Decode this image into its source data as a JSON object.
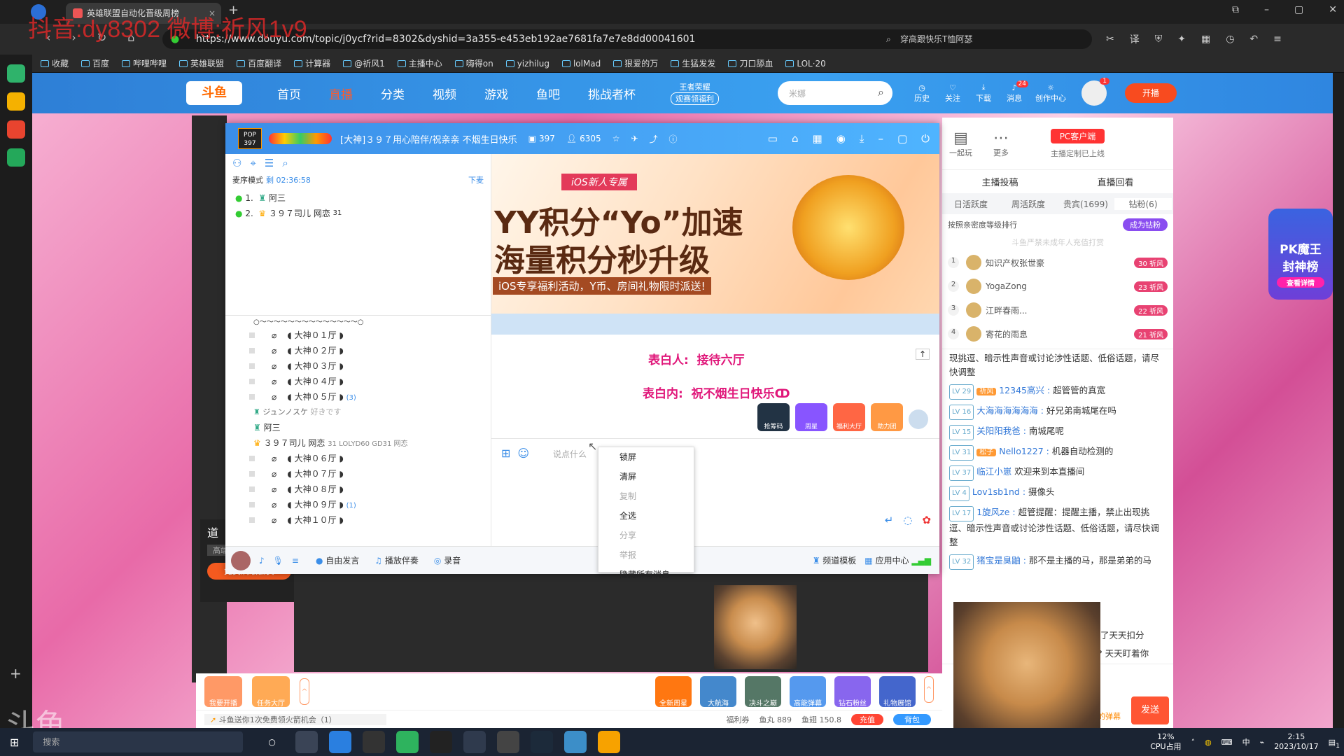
{
  "browser": {
    "tab_title": "英雄联盟自动化晋级周榜",
    "url": "https://www.douyu.com/topic/j0ycf?rid=8302&dyshid=3a355-e453eb192ae7681fa7e7e8dd00041601",
    "search_text": "穿高跟快乐T恤阿瑟",
    "watermark": "抖音:dy8302 微博:祈风1v9",
    "bookmarks": [
      "收藏",
      "百度",
      "哔哩哔哩",
      "英雄联盟",
      "百度翻译",
      "计算器",
      "@祈风1",
      "主播中心",
      "嗨得on",
      "yizhilug",
      "lolMad",
      "狠爱的万",
      "生猛发发",
      "刀口舔血",
      "LOL·20"
    ]
  },
  "douyu_nav": {
    "logo": "斗鱼",
    "items": [
      "首页",
      "直播",
      "分类",
      "视频",
      "游戏",
      "鱼吧",
      "挑战者杯"
    ],
    "promo_top": "王者荣耀",
    "promo_bottom": "观赛领福利",
    "search_placeholder": "米娜",
    "right": [
      "历史",
      "关注",
      "下载",
      "消息",
      "创作中心"
    ],
    "msg_badge": "24",
    "avatar_badge": "1",
    "live_btn": "开播"
  },
  "yy": {
    "pop_label": "POP",
    "pop_num": "397",
    "title": "[大神]３９７用心陪伴/祝亲亲 不烟生日快乐",
    "id_num": "397",
    "people": "6305",
    "mode_label": "麦序模式",
    "mode_time": "剩 02:36:58",
    "mic_queue": "下麦",
    "queue": [
      {
        "num": "1.",
        "name": "阿三"
      },
      {
        "num": "2.",
        "name": "３９７司儿 网恋",
        "extra": "31"
      }
    ],
    "channels_header": "○～～～～～～～～～～～～～～○",
    "channels": [
      {
        "name": "大神０１厅",
        "count": ""
      },
      {
        "name": "大神０２厅",
        "count": ""
      },
      {
        "name": "大神０３厅",
        "count": ""
      },
      {
        "name": "大神０４厅",
        "count": ""
      },
      {
        "name": "大神０５厅",
        "count": "(3)"
      }
    ],
    "users": [
      {
        "name": "ジュンノスケ",
        "extra": "好きです"
      },
      {
        "name": "阿三",
        "extra": ""
      },
      {
        "name": "３９７司儿 网恋",
        "extra": "31  LOLYD60 GD31 网恋"
      }
    ],
    "channels2": [
      {
        "name": "大神０６厅",
        "count": ""
      },
      {
        "name": "大神０７厅",
        "count": ""
      },
      {
        "name": "大神０８厅",
        "count": ""
      },
      {
        "name": "大神０９厅",
        "count": "(1)"
      },
      {
        "name": "大神１０厅",
        "count": ""
      }
    ],
    "banner": {
      "tag": "iOS新人专属",
      "line1": "YY积分“Yo”加速",
      "line2": "海量积分秒升级",
      "line3": "iOS专享福利活动，Y币、房间礼物限时派送!"
    },
    "confess_from_label": "表白人:",
    "confess_from": "接待六厅",
    "confess_to_label": "表白内:",
    "confess_to": "祝不烟生日快乐ↀ",
    "activity_icons": [
      "抢筹码",
      "周星",
      "福利大厅",
      "助力团"
    ],
    "input_placeholder": "说点什么",
    "bottom": [
      "自由发言",
      "播放伴奏",
      "录音",
      "频道模板",
      "应用中心"
    ]
  },
  "context_menu": [
    "锁屏",
    "清屏",
    "复制",
    "全选",
    "分享",
    "举报",
    "隐藏所有消息"
  ],
  "context_menu_disabled": [
    false,
    false,
    true,
    false,
    true,
    true,
    false
  ],
  "douyu_right": {
    "top_icons": [
      "一起玩",
      "更多"
    ],
    "pc_client": "PC客户端",
    "pc_sub": "主播定制已上线",
    "links": [
      "主播投稿",
      "直播回看"
    ],
    "tabs": [
      "日活跃度",
      "周活跃度",
      "贵宾(1699)",
      "钻粉(6)"
    ],
    "sort_label": "按照亲密度等级排行",
    "become_fan": "成为钻粉",
    "notice": "斗鱼严禁未成年人充值打赏",
    "ranks": [
      {
        "n": "1",
        "name": "知识产权张世豪",
        "lv": "30",
        "badge": "祈风"
      },
      {
        "n": "2",
        "name": "YogaZong",
        "lv": "23",
        "badge": "祈风"
      },
      {
        "n": "3",
        "name": "江畔春雨...",
        "lv": "22",
        "badge": "祈风"
      },
      {
        "n": "4",
        "name": "寄花的雨息",
        "lv": "21",
        "badge": "祈风"
      }
    ],
    "messages": [
      {
        "lv": "",
        "badge": "",
        "nick": "",
        "text": "现挑逗、暗示性声音或讨论涉性话题、低俗话题，请尽快调整"
      },
      {
        "lv": "LV 29",
        "badge": "祈风",
        "nick": "12345高兴 :",
        "text": "超管管的真宽"
      },
      {
        "lv": "LV 16",
        "badge": "",
        "nick": "大海海海海海海 :",
        "text": "好兄弟南城尾在吗"
      },
      {
        "lv": "LV 15",
        "badge": "",
        "nick": "关阳阳我爸 :",
        "text": "南城尾呢"
      },
      {
        "lv": "LV 31",
        "badge": "松子",
        "nick": "Nello1227 :",
        "text": "机器自动检测的"
      },
      {
        "lv": "LV 37",
        "badge": "",
        "nick": "临江小崽",
        "text": "欢迎来到本直播间"
      },
      {
        "lv": "LV 4",
        "badge": "",
        "nick": "Lov1sb1nd :",
        "text": "摄像头"
      },
      {
        "lv": "LV 17",
        "badge": "",
        "nick": "1旋风ze :",
        "text": "超管提醒：提醒主播，禁止出现挑逗、暗示性声音或讨论涉性话题、低俗话题，请尽快调整"
      },
      {
        "lv": "LV 32",
        "badge": "",
        "nick": "猪宝是臭鼬 :",
        "text": "那不是主播的马，那是弟弟的马"
      }
    ],
    "cut_text1": "了天天扣分",
    "cut_text2": "? 天天盯着你",
    "send": "发送",
    "send_hint": "的弹幕"
  },
  "pk_badge": {
    "line1": "PK魔王",
    "line2": "封神榜",
    "line3": "查看详情"
  },
  "left_under": {
    "title": "道",
    "tabs": [
      "高端",
      "打会"
    ],
    "btn": "免费满级会员",
    "watermark": "斗鱼"
  },
  "gifts": {
    "left": [
      "我要开播",
      "任务大厅"
    ],
    "right": [
      "全新周星",
      "大航海",
      "决斗之巅",
      "高能弹幕",
      "钻石粉丝",
      "礼物展馆"
    ],
    "tip": "斗鱼送你1次免费领火箭机会（1）",
    "welfare": "福利券",
    "fish_ball": "鱼丸 889",
    "fish_fin": "鱼翅 150.8",
    "recharge": "充值",
    "bag": "背包"
  },
  "taskbar": {
    "search": "搜索",
    "cpu_pct": "12%",
    "cpu_label": "CPU占用",
    "time": "2:15",
    "date": "2023/10/17",
    "ime": "中",
    "notif": "1"
  }
}
